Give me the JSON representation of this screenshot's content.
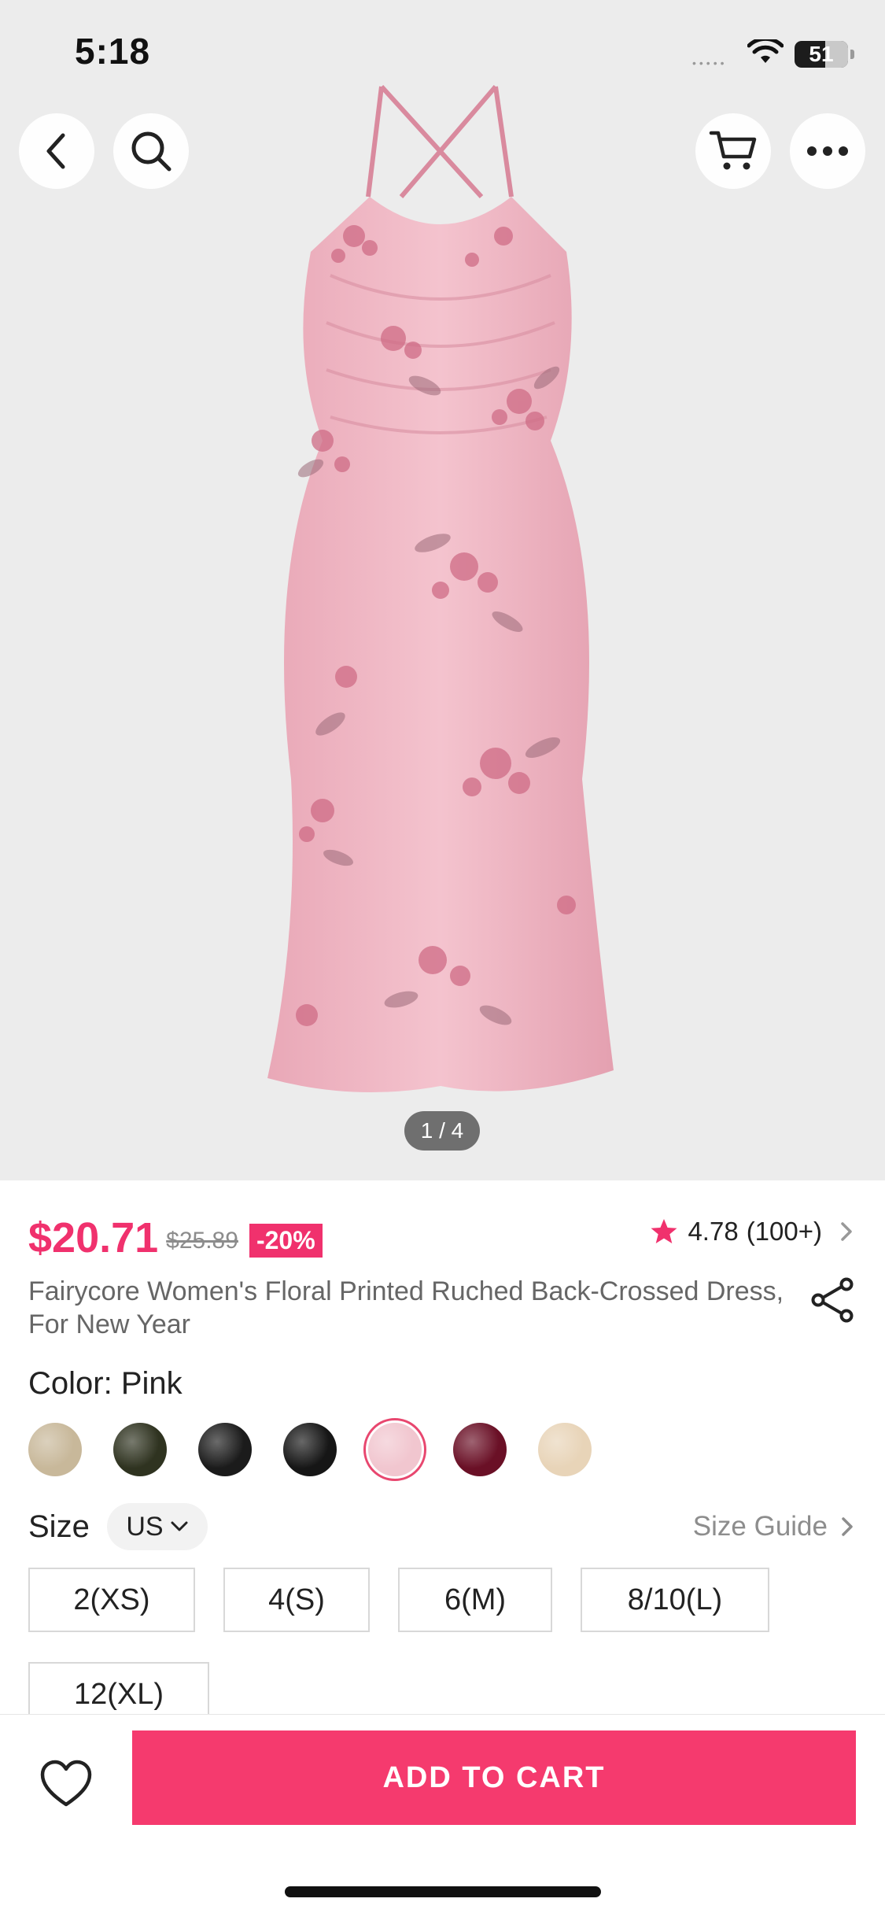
{
  "status_bar": {
    "time": "5:18",
    "battery": "51"
  },
  "header": {
    "back_icon": "chevron-left-icon",
    "search_icon": "search-icon",
    "cart_icon": "cart-icon",
    "more_icon": "more-dots-icon"
  },
  "gallery": {
    "pager": "1 / 4",
    "image_subject": "pink floral dress"
  },
  "product": {
    "price": "$20.71",
    "original_price": "$25.89",
    "discount": "-20%",
    "rating": "4.78",
    "rating_count": "(100+)",
    "title": "Fairycore Women's Floral Printed Ruched Back-Crossed Dress, For New Year"
  },
  "color": {
    "label": "Color: Pink",
    "selected_index": 4,
    "swatch_colors": [
      "#c8b89a",
      "#2f3320",
      "#1b1b1b",
      "#161616",
      "#f1c6cf",
      "#6a1026",
      "#e8d4b8"
    ]
  },
  "size": {
    "label": "Size",
    "unit": "US",
    "guide": "Size Guide",
    "options": [
      "2(XS)",
      "4(S)",
      "6(M)",
      "8/10(L)",
      "12(XL)"
    ]
  },
  "bottom": {
    "add_to_cart": "ADD TO CART"
  },
  "colors": {
    "accent": "#f0316d",
    "button": "#f53a6e",
    "hero_bg": "#ececec"
  }
}
